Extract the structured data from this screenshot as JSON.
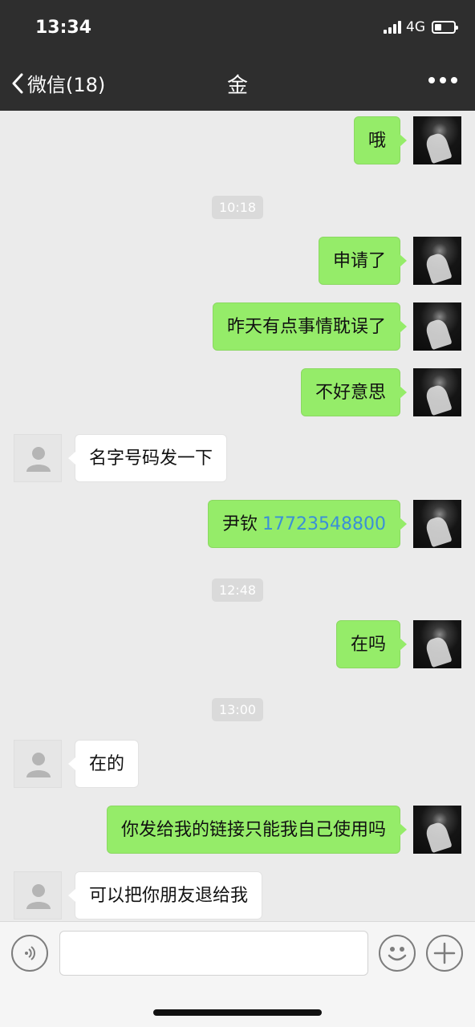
{
  "status_bar": {
    "time": "13:34",
    "network": "4G",
    "battery_level": 0.35
  },
  "nav": {
    "back_label": "微信(18)",
    "title": "金"
  },
  "messages": [
    {
      "type": "me",
      "text": "哦"
    },
    {
      "type": "time",
      "text": "10:18"
    },
    {
      "type": "me",
      "text": "申请了"
    },
    {
      "type": "me",
      "text": "昨天有点事情耽误了"
    },
    {
      "type": "me",
      "text": "不好意思"
    },
    {
      "type": "other",
      "text": "名字号码发一下"
    },
    {
      "type": "me",
      "text": "尹钦",
      "link": "17723548800"
    },
    {
      "type": "time",
      "text": "12:48"
    },
    {
      "type": "me",
      "text": "在吗"
    },
    {
      "type": "time",
      "text": "13:00"
    },
    {
      "type": "other",
      "text": "在的"
    },
    {
      "type": "me",
      "text": "你发给我的链接只能我自己使用吗"
    },
    {
      "type": "other",
      "text": "可以把你朋友退给我"
    }
  ],
  "colors": {
    "header": "#2e2e2e",
    "bubble_me": "#95ec69",
    "bubble_other": "#ffffff",
    "link": "#3a8fd8",
    "chat_bg": "#ebebeb"
  },
  "icons": {
    "back": "chevron-left-icon",
    "more": "more-dots-icon",
    "voice": "voice-icon",
    "emoji": "emoji-icon",
    "plus": "plus-icon"
  }
}
